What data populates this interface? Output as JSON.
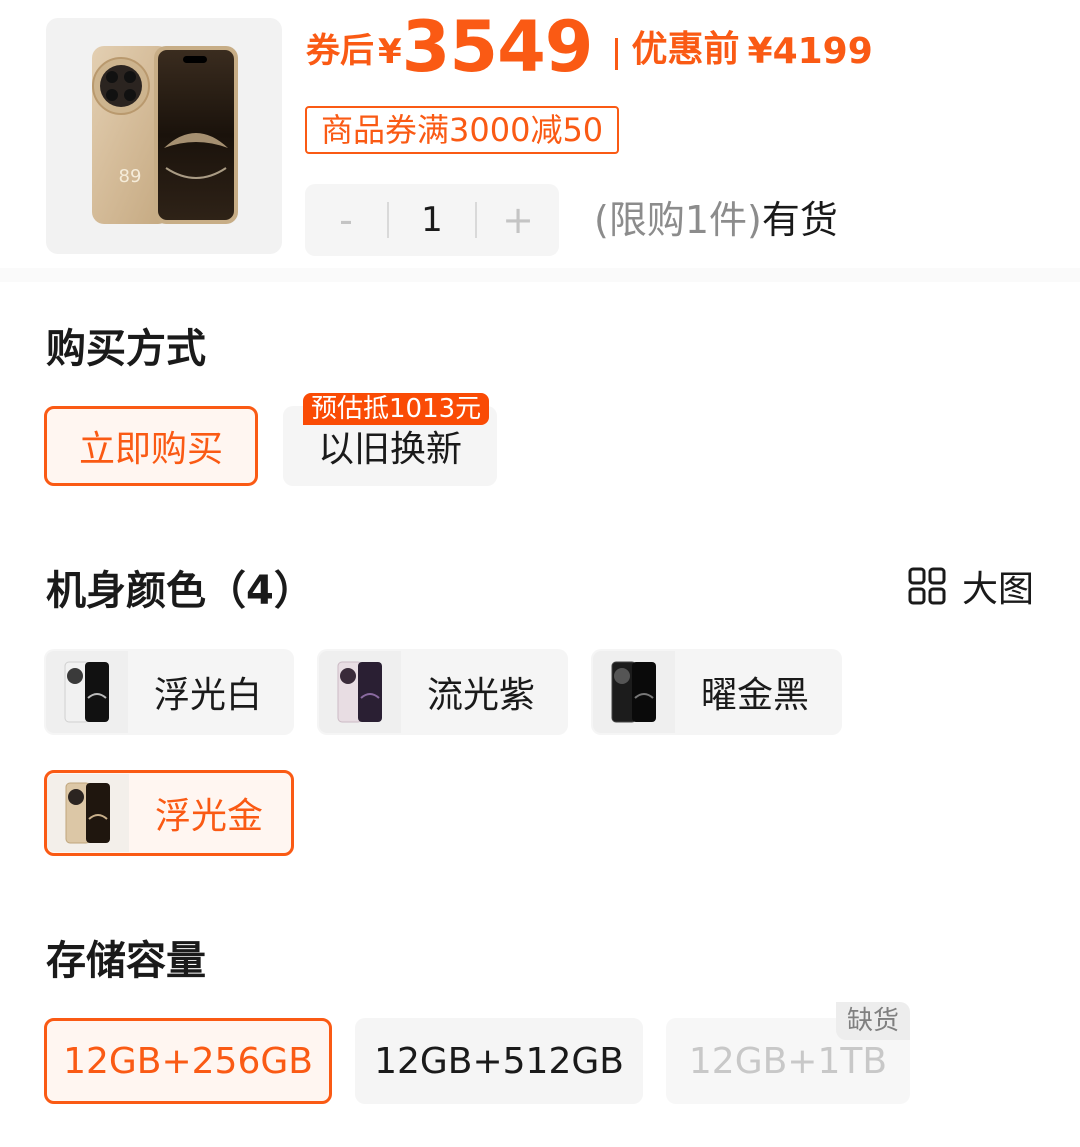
{
  "product": {
    "coupon_after_label": "券后",
    "currency": "¥",
    "price_after": "3549",
    "price_before_label": "优惠前",
    "price_before": "¥4199",
    "coupon_tag": "商品券满3000减50",
    "quantity": {
      "minus": "-",
      "value": "1",
      "plus": "+"
    },
    "limit_text": "(限购1件)",
    "stock_text": "有货"
  },
  "purchase_method": {
    "title": "购买方式",
    "options": [
      {
        "label": "立即购买",
        "selected": true
      },
      {
        "label": "以旧换新",
        "badge": "预估抵1013元",
        "selected": false
      }
    ]
  },
  "color": {
    "title": "机身颜色（4）",
    "big_picture_label": "大图",
    "big_picture_icon": "grid-icon",
    "options": [
      {
        "label": "浮光白",
        "selected": false
      },
      {
        "label": "流光紫",
        "selected": false
      },
      {
        "label": "曜金黑",
        "selected": false
      },
      {
        "label": "浮光金",
        "selected": true
      }
    ]
  },
  "storage": {
    "title": "存储容量",
    "options": [
      {
        "label": "12GB+256GB",
        "selected": true
      },
      {
        "label": "12GB+512GB",
        "selected": false
      },
      {
        "label": "12GB+1TB",
        "selected": false,
        "disabled": true,
        "badge": "缺货"
      }
    ]
  },
  "colors": {
    "accent": "#fa5a14",
    "badge_bg": "#fa4b05",
    "option_bg": "#f5f5f5"
  }
}
